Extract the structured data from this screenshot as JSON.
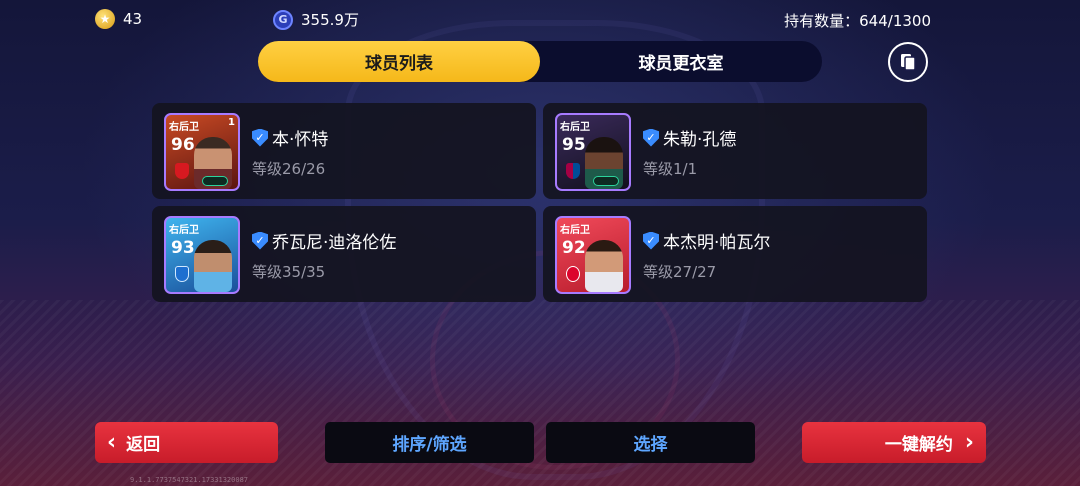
{
  "currency": {
    "coins": "43",
    "gp_icon": "G",
    "gp": "355.9万"
  },
  "holding": "持有数量：644/1300",
  "tabs": [
    {
      "label": "球员列表",
      "active": true
    },
    {
      "label": "球员更衣室",
      "active": false
    }
  ],
  "players": [
    {
      "position": "右后卫",
      "rating": "96",
      "corner": "1",
      "name": "本·怀特",
      "level": "等级26/26",
      "card_color": "#7a2a1e"
    },
    {
      "position": "右后卫",
      "rating": "95",
      "corner": "",
      "name": "朱勒·孔德",
      "level": "等级1/1",
      "card_color": "#2a1a4a"
    },
    {
      "position": "右后卫",
      "rating": "93",
      "corner": "",
      "name": "乔瓦尼·迪洛伦佐",
      "level": "等级35/35",
      "card_color": "#1f6fb8"
    },
    {
      "position": "右后卫",
      "rating": "92",
      "corner": "",
      "name": "本杰明·帕瓦尔",
      "level": "等级27/27",
      "card_color": "#c8283a"
    }
  ],
  "buttons": {
    "back": "返回",
    "sort_filter": "排序/筛选",
    "select": "选择",
    "release_all": "一键解约"
  },
  "icons": {
    "coin": "star-coin-icon",
    "gp": "gp-coin-icon",
    "copy": "copy-icon",
    "back": "chevron-left-icon",
    "forward": "chevron-right-icon",
    "verified": "shield-check-icon"
  },
  "build_info": "9.1.1.7737547321.17331320087"
}
